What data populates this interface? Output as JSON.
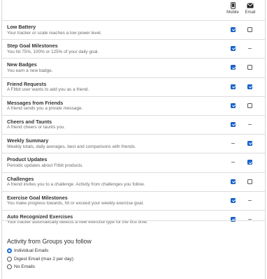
{
  "columns": {
    "mobile_label": "Mobile",
    "email_label": "Email",
    "mobile_icon": "mobile-phone-icon",
    "email_icon": "envelope-icon"
  },
  "colors": {
    "accent": "#1a6ad8"
  },
  "notifications": [
    {
      "title": "Low Battery",
      "description": "Your tracker or scale reaches a low power level.",
      "mobile": "checked",
      "email": "unchecked"
    },
    {
      "title": "Step Goal Milestones",
      "description": "You hit 75%, 100% or 125% of your daily goal.",
      "mobile": "checked",
      "email": "none"
    },
    {
      "title": "New Badges",
      "description": "You earn a new badge.",
      "mobile": "checked",
      "email": "unchecked"
    },
    {
      "title": "Friend Requests",
      "description": "A Fitbit user wants to add you as a friend.",
      "mobile": "checked",
      "email": "checked"
    },
    {
      "title": "Messages from Friends",
      "description": "A friend sends you a private message.",
      "mobile": "checked",
      "email": "unchecked"
    },
    {
      "title": "Cheers and Taunts",
      "description": "A friend cheers or taunts you.",
      "mobile": "checked",
      "email": "none"
    },
    {
      "title": "Weekly Summary",
      "description": "Weekly totals, daily averages, best and comparisons with friends.",
      "mobile": "none",
      "email": "checked"
    },
    {
      "title": "Product Updates",
      "description": "Periodic updates about Fitbit products.",
      "mobile": "none",
      "email": "checked"
    },
    {
      "title": "Challenges",
      "description": "A friend invites you to a challenge. Activity from challenges you follow.",
      "mobile": "checked",
      "email": "unchecked"
    },
    {
      "title": "Exercise Goal Milestones",
      "description": "You make progress towards, hit or exceed your weekly exercise goal.",
      "mobile": "checked",
      "email": "none"
    },
    {
      "title": "Auto Recognized Exercises",
      "description": "Your tracker automatically detects a new exercise type for the first time.",
      "mobile": "checked",
      "email": "none"
    }
  ],
  "groups": {
    "title": "Activity from Groups you follow",
    "options": [
      {
        "label": "Individual Emails",
        "selected": true
      },
      {
        "label": "Digest Email (max 2 per day)",
        "selected": false
      },
      {
        "label": "No Emails",
        "selected": false
      }
    ]
  }
}
